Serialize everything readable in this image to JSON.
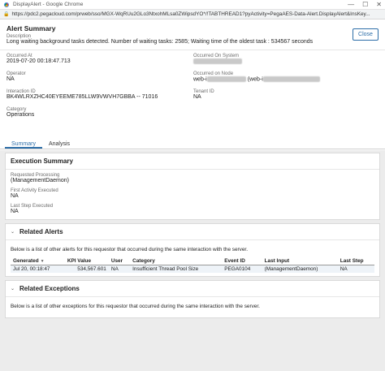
{
  "window": {
    "title": "DisplayAlert - Google Chrome",
    "url": "https://pdc2.pegacloud.com/prweb/sso/MGX-WqRUu2GLo3NtxohMLsa0ZWipsdYO*/!TABTHREAD1?pyActivity=PegaAES-Data-Alert.DisplayAlert&InsKey..."
  },
  "header": {
    "title": "Alert Summary",
    "description_label": "Description",
    "description": "Long waiting background tasks detected. Number of waiting tasks: 2585; Waiting time of the oldest task : 534567 seconds",
    "close_label": "Close"
  },
  "fields": {
    "occurred_at_label": "Occurred At",
    "occurred_at": "2019-07-20 00:18:47.713",
    "occurred_on_system_label": "Occurred On System",
    "operator_label": "Operator",
    "operator": "NA",
    "occurred_on_node_label": "Occurred on Node",
    "occurred_on_node_prefix": "web-i",
    "occurred_on_node_mid": "(web-i",
    "interaction_id_label": "Interaction ID",
    "interaction_id": "BK4WLRXZHC40EYEEME785LLW9VWVH7GBBA -- 71016",
    "tenant_id_label": "Tenant ID",
    "tenant_id": "NA",
    "category_label": "Category",
    "category": "Operations"
  },
  "tabs": [
    "Summary",
    "Analysis"
  ],
  "execution": {
    "title": "Execution Summary",
    "requested_processing_label": "Requested Processing",
    "requested_processing": "(ManagementDaemon)",
    "first_activity_label": "First Activity Executed",
    "first_activity": "NA",
    "last_step_label": "Last Step Executed",
    "last_step": "NA"
  },
  "related_alerts": {
    "title": "Related Alerts",
    "description": "Below is a list of other alerts for this requestor that occurred during the same interaction with the server.",
    "columns": [
      "Generated",
      "KPI Value",
      "User",
      "Category",
      "Event ID",
      "Last Input",
      "Last Step"
    ],
    "rows": [
      [
        "Jul 20, 00:18:47",
        "534,567.601",
        "NA",
        "Insufficient Thread Pool Size",
        "PEGA0104",
        "(ManagementDaemon)",
        "NA"
      ]
    ]
  },
  "related_exceptions": {
    "title": "Related Exceptions",
    "description": "Below is a list of other exceptions for this requestor that occurred during the same interaction with the server."
  },
  "icons": {
    "window_minimize": "—",
    "window_maximize": "☐",
    "window_close": "✕",
    "lock": "lock-icon",
    "chevron": "chevron-down-icon"
  }
}
